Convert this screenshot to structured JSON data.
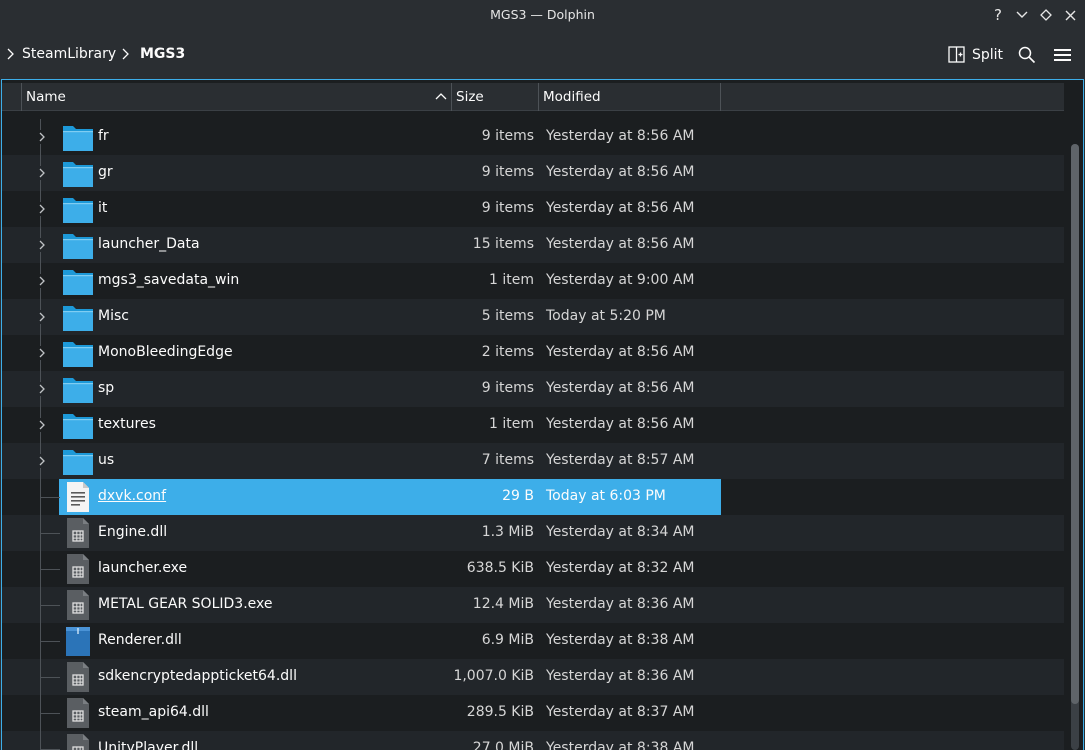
{
  "window": {
    "title": "MGS3 — Dolphin",
    "help_glyph": "?",
    "minimize_glyph": "⌄",
    "maximize_glyph": "◇",
    "close_glyph": "✕"
  },
  "breadcrumb": {
    "items": [
      "SteamLibrary",
      "MGS3"
    ]
  },
  "toolbar": {
    "split_label": "Split",
    "split_icon": "split-view-icon",
    "search_icon": "search-icon",
    "menu_icon": "hamburger-menu-icon"
  },
  "columns": {
    "name": "Name",
    "size": "Size",
    "modified": "Modified"
  },
  "partial_top_row": {
    "name": "",
    "modified": ""
  },
  "rows": [
    {
      "name": "fr",
      "size": "9 items",
      "modified": "Yesterday at 8:56 AM",
      "type": "folder"
    },
    {
      "name": "gr",
      "size": "9 items",
      "modified": "Yesterday at 8:56 AM",
      "type": "folder"
    },
    {
      "name": "it",
      "size": "9 items",
      "modified": "Yesterday at 8:56 AM",
      "type": "folder"
    },
    {
      "name": "launcher_Data",
      "size": "15 items",
      "modified": "Yesterday at 8:56 AM",
      "type": "folder"
    },
    {
      "name": "mgs3_savedata_win",
      "size": "1 item",
      "modified": "Yesterday at 9:00 AM",
      "type": "folder"
    },
    {
      "name": "Misc",
      "size": "5 items",
      "modified": "Today at 5:20 PM",
      "type": "folder"
    },
    {
      "name": "MonoBleedingEdge",
      "size": "2 items",
      "modified": "Yesterday at 8:56 AM",
      "type": "folder"
    },
    {
      "name": "sp",
      "size": "9 items",
      "modified": "Yesterday at 8:56 AM",
      "type": "folder"
    },
    {
      "name": "textures",
      "size": "1 item",
      "modified": "Yesterday at 8:56 AM",
      "type": "folder"
    },
    {
      "name": "us",
      "size": "7 items",
      "modified": "Yesterday at 8:57 AM",
      "type": "folder"
    },
    {
      "name": "dxvk.conf",
      "size": "29 B",
      "modified": "Today at 6:03 PM",
      "type": "text",
      "selected": true
    },
    {
      "name": "Engine.dll",
      "size": "1.3 MiB",
      "modified": "Yesterday at 8:34 AM",
      "type": "binary"
    },
    {
      "name": "launcher.exe",
      "size": "638.5 KiB",
      "modified": "Yesterday at 8:32 AM",
      "type": "binary"
    },
    {
      "name": "METAL GEAR SOLID3.exe",
      "size": "12.4 MiB",
      "modified": "Yesterday at 8:36 AM",
      "type": "binary"
    },
    {
      "name": "Renderer.dll",
      "size": "6.9 MiB",
      "modified": "Yesterday at 8:38 AM",
      "type": "library"
    },
    {
      "name": "sdkencryptedappticket64.dll",
      "size": "1,007.0 KiB",
      "modified": "Yesterday at 8:36 AM",
      "type": "binary"
    },
    {
      "name": "steam_api64.dll",
      "size": "289.5 KiB",
      "modified": "Yesterday at 8:37 AM",
      "type": "binary"
    },
    {
      "name": "UnityPlayer.dll",
      "size": "27.0 MiB",
      "modified": "Yesterday at 8:38 AM",
      "type": "binary"
    }
  ],
  "colors": {
    "accent": "#3daee9",
    "folder": "#3daee9",
    "background": "#1b1e20",
    "alt_row": "#22262a",
    "chrome": "#2a2e32"
  }
}
